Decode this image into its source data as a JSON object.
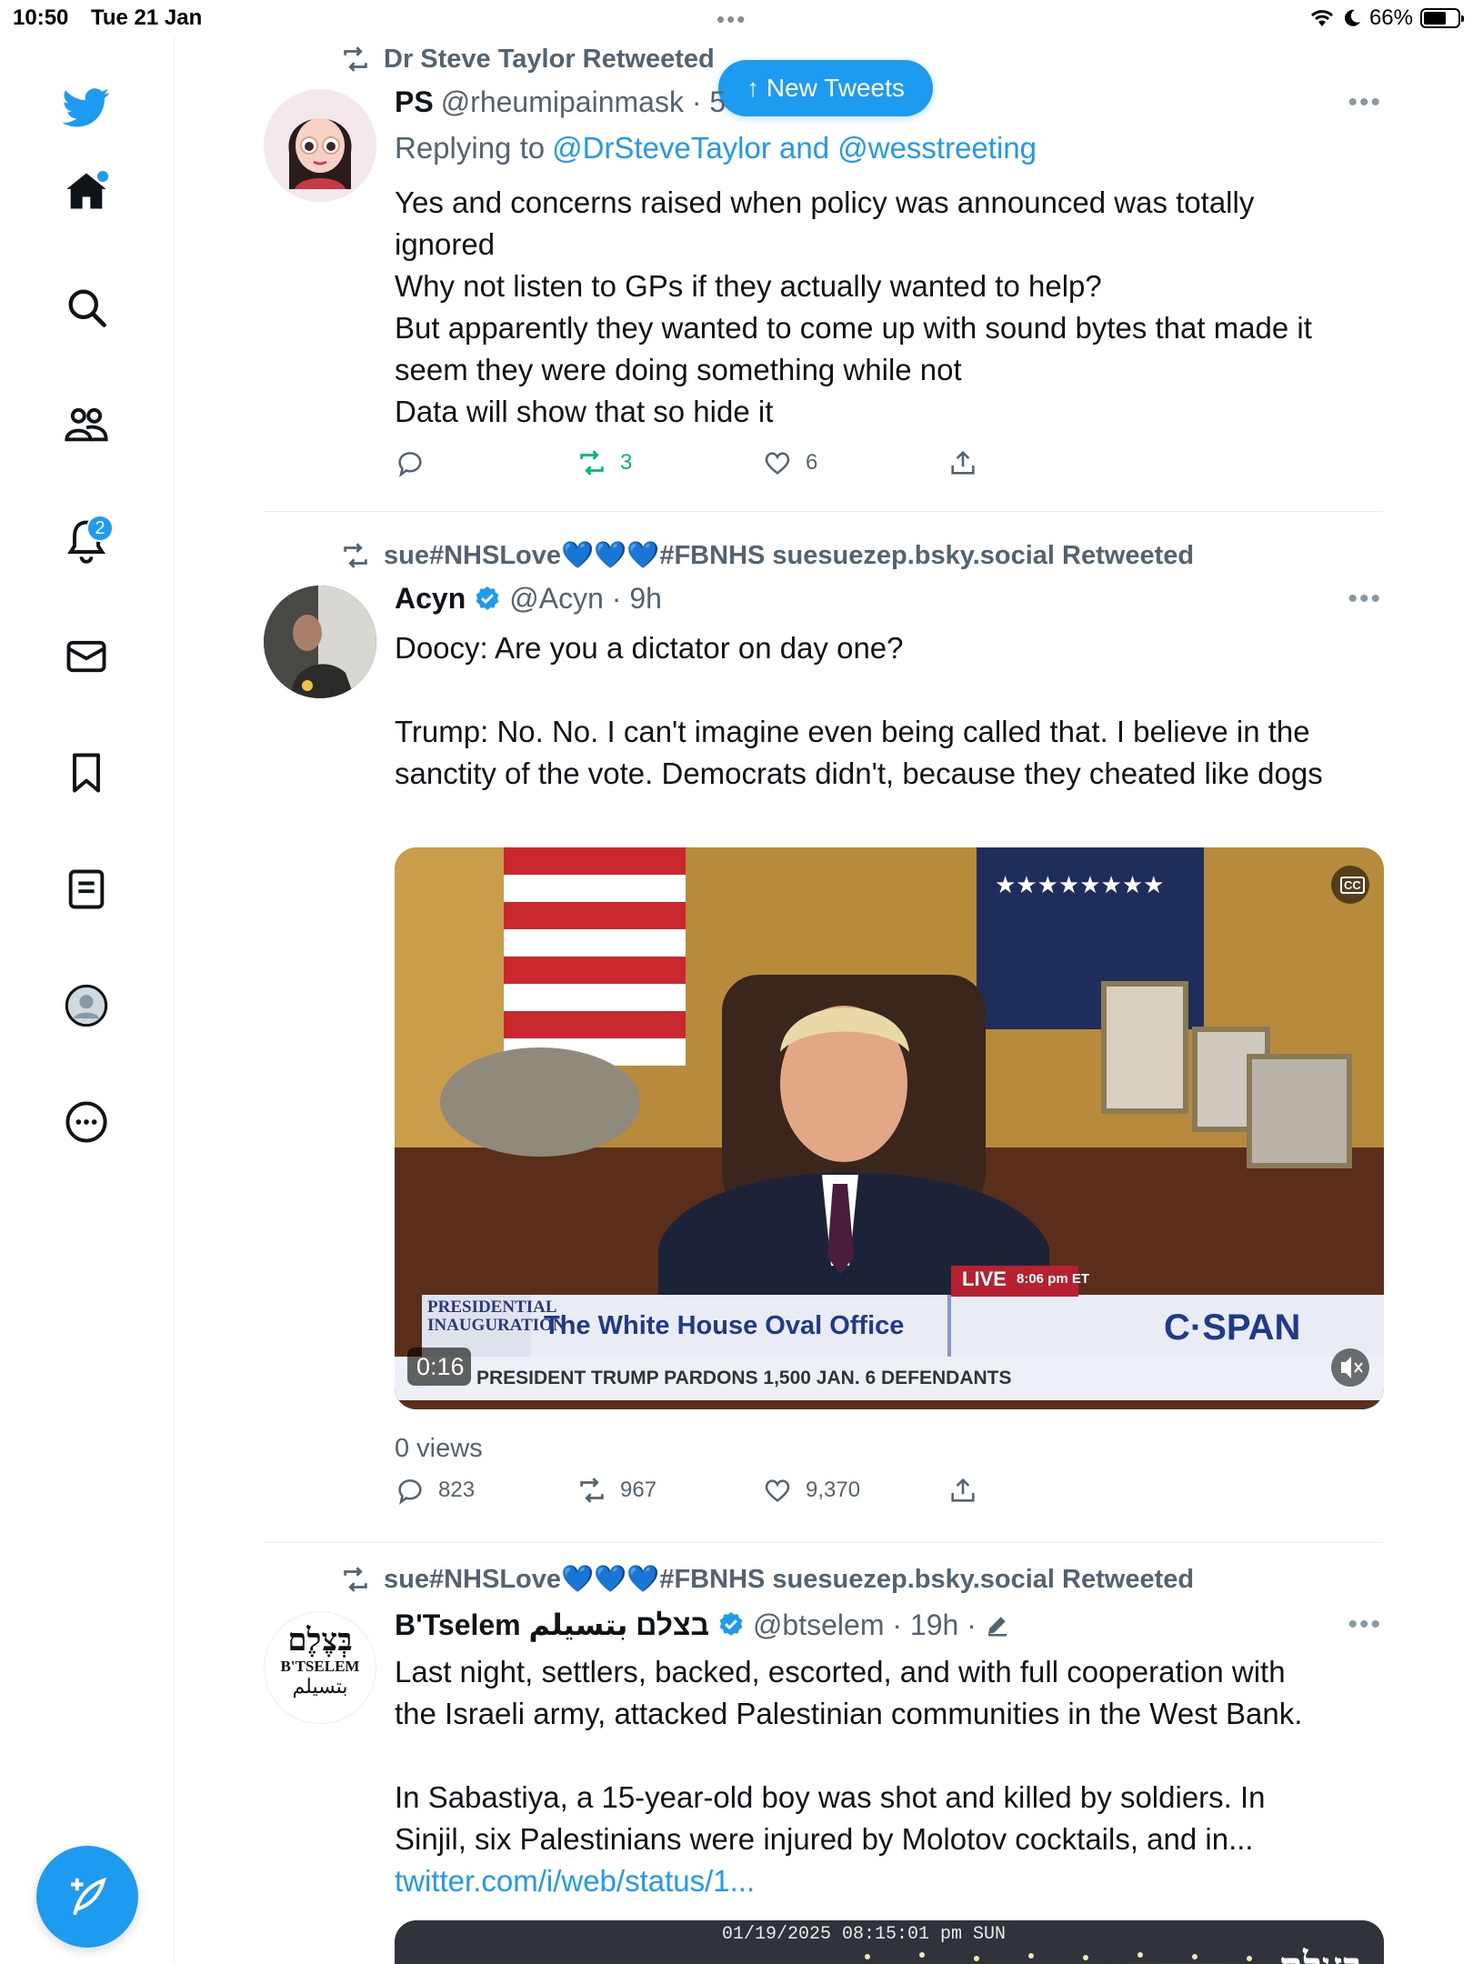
{
  "status_bar": {
    "time": "10:50",
    "date": "Tue 21 Jan",
    "battery": "66%",
    "battery_level": 0.66
  },
  "sidebar": {
    "items": [
      {
        "icon": "twitter-bird-icon"
      },
      {
        "icon": "home-icon"
      },
      {
        "icon": "search-icon"
      },
      {
        "icon": "communities-icon"
      },
      {
        "icon": "notifications-icon",
        "badge": "2"
      },
      {
        "icon": "messages-icon"
      },
      {
        "icon": "bookmarks-icon"
      },
      {
        "icon": "lists-icon"
      },
      {
        "icon": "profile-icon"
      },
      {
        "icon": "more-icon"
      }
    ],
    "compose_icon": "compose-icon"
  },
  "new_tweets_pill": "↑ New Tweets",
  "tweets": [
    {
      "retweeted_by": "Dr Steve Taylor Retweeted",
      "name": "PS",
      "handle": "@rheumipainmask · 5",
      "replying_prefix": "Replying to",
      "replying_to": "@DrSteveTaylor and @wesstreeting",
      "text": "Yes and concerns raised when policy was announced was totally\nignored\nWhy not listen to GPs if they actually wanted to help?\nBut apparently they wanted to come up with sound bytes that made it\nseem they were doing something while not\nData will show that so hide it",
      "replies": "",
      "retweets": "3",
      "likes": "6"
    },
    {
      "retweeted_by": "sue#NHSLove💙💙💙#FBNHS suesuezep.bsky.social Retweeted",
      "name": "Acyn",
      "handle": "@Acyn · 9h",
      "text": "Doocy: Are you a dictator on day one?\n\nTrump: No. No. I can't imagine even being called that. I believe in the\nsanctity of the vote. Democrats didn't, because they cheated like dogs",
      "video": {
        "duration": "0:16",
        "chyron_left": "PRESIDENTIAL INAUGURATION",
        "chyron_title": "The White House Oval Office",
        "chyron_network": "C·SPAN",
        "live": "LIVE",
        "live_time": "8:06 pm ET",
        "ticker": "PRESIDENT TRUMP PARDONS 1,500 JAN. 6 DEFENDANTS",
        "cc": "CC"
      },
      "views": "0 views",
      "replies": "823",
      "retweets": "967",
      "likes": "9,370"
    },
    {
      "retweeted_by": "sue#NHSLove💙💙💙#FBNHS suesuezep.bsky.social Retweeted",
      "name": "B'Tselem בצלם بتسيلم",
      "handle": "@btselem · 19h ·",
      "text": "Last night, settlers, backed, escorted, and with full cooperation with\nthe Israeli army, attacked Palestinian communities in the West Bank.\n\nIn  Sabastiya, a 15-year-old boy was  shot and killed by soldiers. In\nSinjil, six Palestinians were injured by Molotov cocktails, and in...",
      "link": "twitter.com/i/web/status/1...",
      "avatar_text_top": "בְּצֶלֶם",
      "avatar_text_mid": "B'TSELEM",
      "avatar_text_bot": "بتسيلم",
      "media_timestamp": "01/19/2025 08:15:01 pm SUN",
      "media_logo": "בְּצֶלֶם"
    }
  ],
  "colors": {
    "accent": "#1d9bf0",
    "retweet_green": "#00ba7c",
    "text": "#0f1419",
    "secondary": "#536471"
  }
}
